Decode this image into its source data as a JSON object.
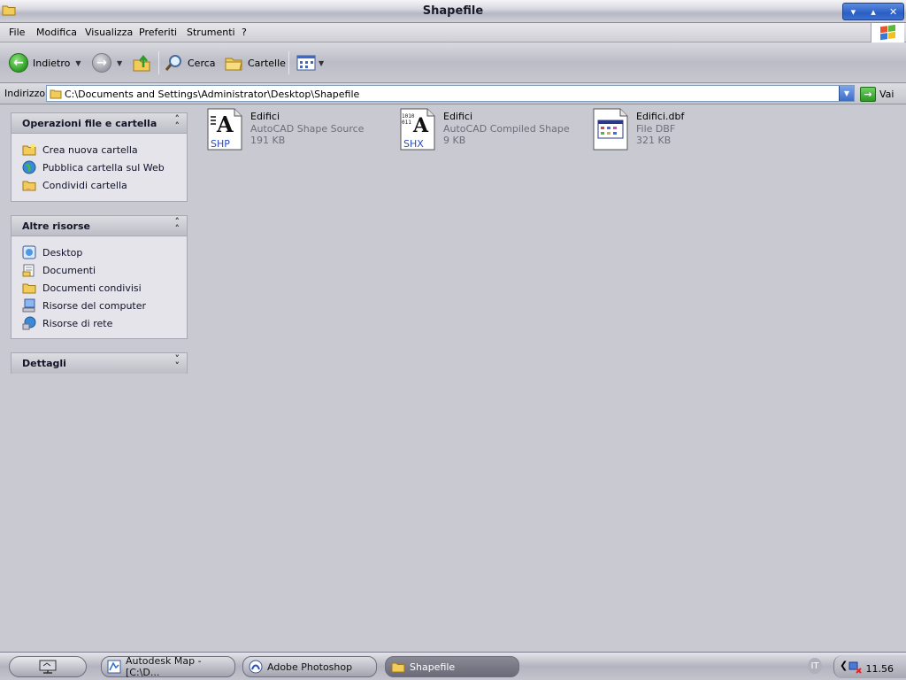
{
  "window": {
    "title": "Shapefile",
    "controls": {
      "minimize": "▾",
      "maximize": "▴",
      "close": "✕"
    }
  },
  "menu": {
    "items": [
      "File",
      "Modifica",
      "Visualizza",
      "Preferiti",
      "Strumenti",
      "?"
    ]
  },
  "toolbar": {
    "back_label": "Indietro",
    "search_label": "Cerca",
    "folders_label": "Cartelle"
  },
  "address": {
    "label": "Indirizzo",
    "path": "C:\\Documents and Settings\\Administrator\\Desktop\\Shapefile",
    "go_label": "Vai"
  },
  "sidebar": {
    "file_tasks": {
      "title": "Operazioni file e cartella",
      "items": [
        {
          "label": "Crea nuova cartella",
          "icon": "new-folder-icon"
        },
        {
          "label": "Pubblica cartella sul Web",
          "icon": "globe-icon"
        },
        {
          "label": "Condividi cartella",
          "icon": "shared-folder-icon"
        }
      ]
    },
    "other_places": {
      "title": "Altre risorse",
      "items": [
        {
          "label": "Desktop",
          "icon": "desktop-icon"
        },
        {
          "label": "Documenti",
          "icon": "documents-icon"
        },
        {
          "label": "Documenti condivisi",
          "icon": "folder-icon"
        },
        {
          "label": "Risorse del computer",
          "icon": "computer-icon"
        },
        {
          "label": "Risorse di rete",
          "icon": "network-icon"
        }
      ]
    },
    "details": {
      "title": "Dettagli"
    }
  },
  "files": [
    {
      "name": "Edifici",
      "type": "AutoCAD Shape Source",
      "size": "191 KB",
      "badge": "SHP",
      "icon": "shp-file-icon"
    },
    {
      "name": "Edifici",
      "type": "AutoCAD Compiled Shape",
      "size": "9 KB",
      "badge": "SHX",
      "icon": "shx-file-icon"
    },
    {
      "name": "Edifici.dbf",
      "type": "File DBF",
      "size": "321 KB",
      "badge": "",
      "icon": "dbf-file-icon"
    }
  ],
  "taskbar": {
    "tasks": [
      {
        "label": "Autodesk Map - [C:\\D...",
        "icon": "autodesk-map-icon",
        "active": false
      },
      {
        "label": "Adobe Photoshop",
        "icon": "photoshop-icon",
        "active": false
      },
      {
        "label": "Shapefile",
        "icon": "folder-icon",
        "active": true
      }
    ],
    "language": "IT",
    "clock": "11.56"
  },
  "colors": {
    "desktop_bg": "#c9c9d1",
    "panel_bg": "#e4e4ea",
    "title_blue": "#2a5fc4",
    "go_green": "#2a9a22",
    "secondary_text": "#6e6e78"
  }
}
